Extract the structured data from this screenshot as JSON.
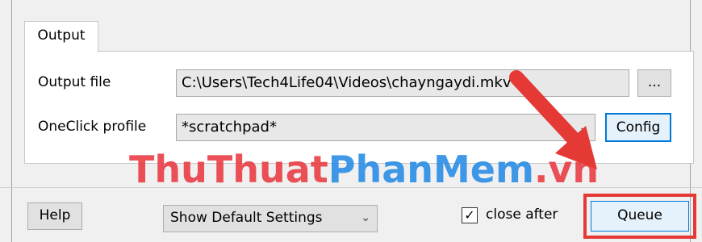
{
  "tab": {
    "label": "Output"
  },
  "output_file": {
    "label": "Output file",
    "value": "C:\\Users\\Tech4Life04\\Videos\\chayngaydi.mkv",
    "browse_label": "..."
  },
  "oneclick": {
    "label": "OneClick profile",
    "value": "*scratchpad*",
    "config_label": "Config"
  },
  "bottom_bar": {
    "help_label": "Help",
    "settings_select": "Show Default Settings",
    "close_after_label": "close after",
    "close_after_checked": true,
    "queue_label": "Queue"
  },
  "watermark": {
    "part1": "ThuThuat",
    "part2": "PhanMem",
    "part3": ".vn",
    "color1": "#e8333a",
    "color2": "#1e88e5"
  },
  "colors": {
    "annotation_red": "#e53935",
    "focus_blue": "#0078d7"
  }
}
